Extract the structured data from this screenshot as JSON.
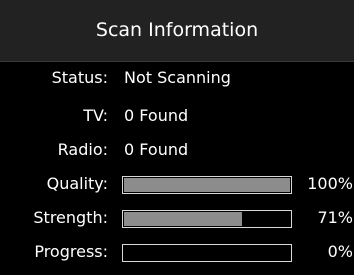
{
  "dialog": {
    "title": "Scan Information"
  },
  "info": {
    "status": {
      "label": "Status:",
      "value": "Not Scanning"
    },
    "tv": {
      "label": "TV:",
      "value": "0 Found"
    },
    "radio": {
      "label": "Radio:",
      "value": "0 Found"
    }
  },
  "meters": {
    "quality": {
      "label": "Quality:",
      "percent_text": "100%",
      "level": 1.0
    },
    "strength": {
      "label": "Strength:",
      "percent_text": "71%",
      "level": 0.71
    },
    "progress": {
      "label": "Progress:",
      "percent_text": "0%",
      "level": 0.0
    }
  },
  "colors": {
    "background": "#000000",
    "title_bar": "#222222",
    "bar_fill": "#8c8c8c",
    "bar_border": "#d8d8d8",
    "text": "#ffffff"
  }
}
